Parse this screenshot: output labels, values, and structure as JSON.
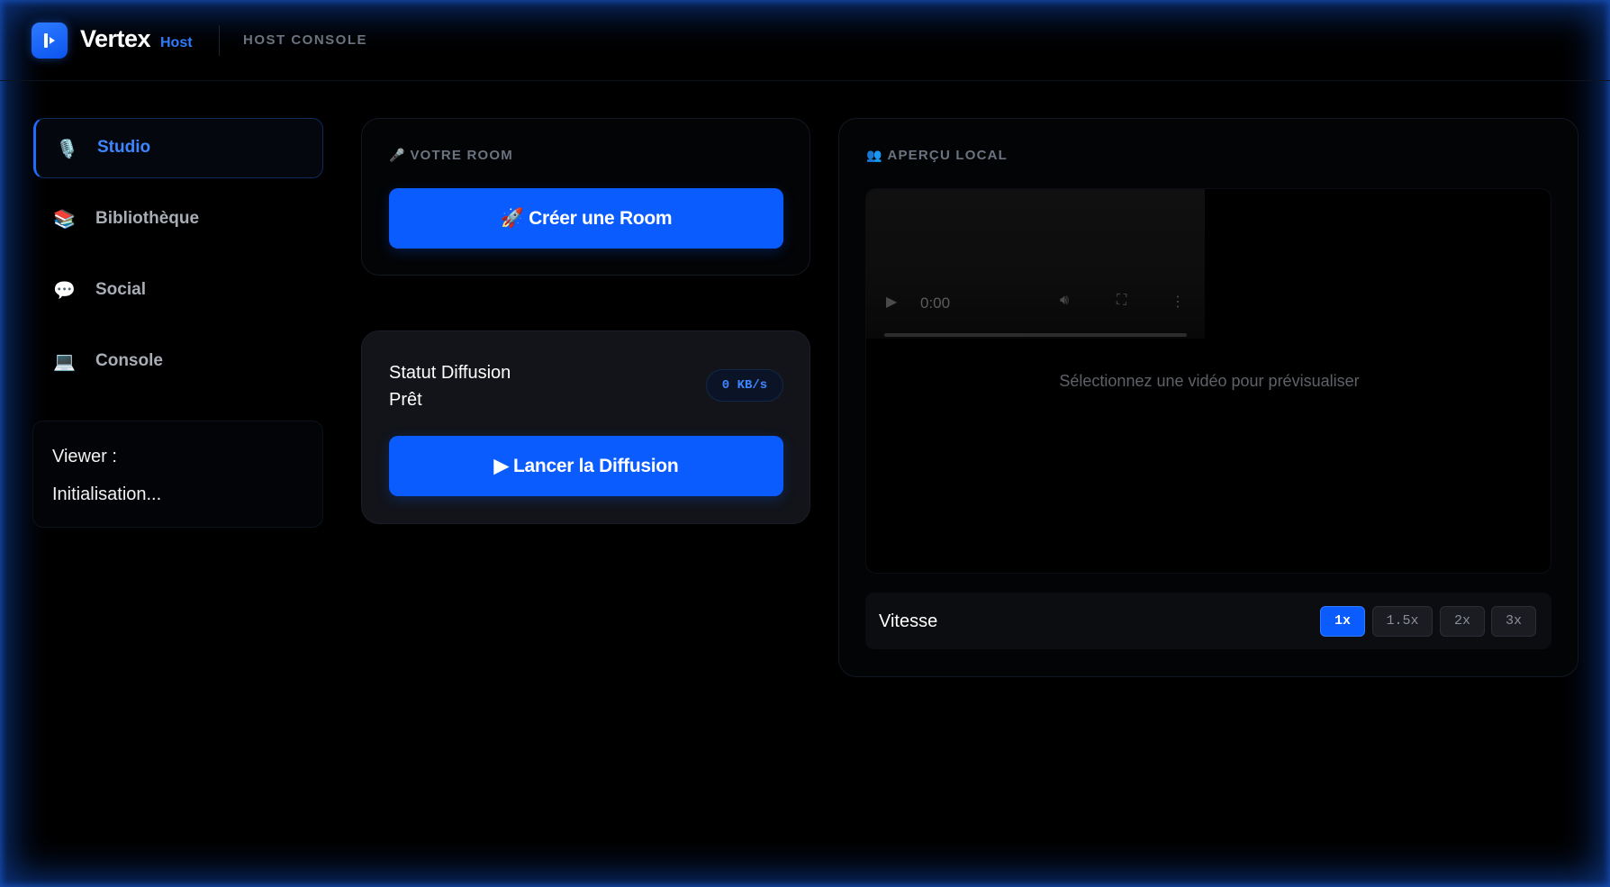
{
  "header": {
    "brand": "Vertex",
    "brand_sub": "Host",
    "title": "HOST CONSOLE"
  },
  "sidebar": {
    "items": [
      {
        "label": "Studio",
        "icon": "microphone-icon",
        "glyph": "🎙️",
        "active": true
      },
      {
        "label": "Bibliothèque",
        "icon": "books-icon",
        "glyph": "📚",
        "active": false
      },
      {
        "label": "Social",
        "icon": "speech-bubble-icon",
        "glyph": "💬",
        "active": false
      },
      {
        "label": "Console",
        "icon": "laptop-icon",
        "glyph": "💻",
        "active": false
      }
    ],
    "viewer": {
      "label": "Viewer :",
      "status": "Initialisation..."
    }
  },
  "room": {
    "heading": "VOTRE ROOM",
    "heading_icon": "🎤",
    "create_button": "🚀 Créer une Room"
  },
  "broadcast": {
    "title": "Statut Diffusion",
    "status": "Prêt",
    "rate": "0 KB/s",
    "launch_button": "▶ Lancer la Diffusion"
  },
  "preview": {
    "heading": "APERÇU LOCAL",
    "heading_icon": "👥",
    "player_time": "0:00",
    "placeholder": "Sélectionnez une vidéo pour prévisualiser",
    "speed_label": "Vitesse",
    "speeds": [
      "1x",
      "1.5x",
      "2x",
      "3x"
    ],
    "selected_speed": "1x"
  },
  "colors": {
    "accent": "#0a5cff",
    "accent_text": "#3d86ff",
    "background": "#000000",
    "glow": "#145adc"
  }
}
